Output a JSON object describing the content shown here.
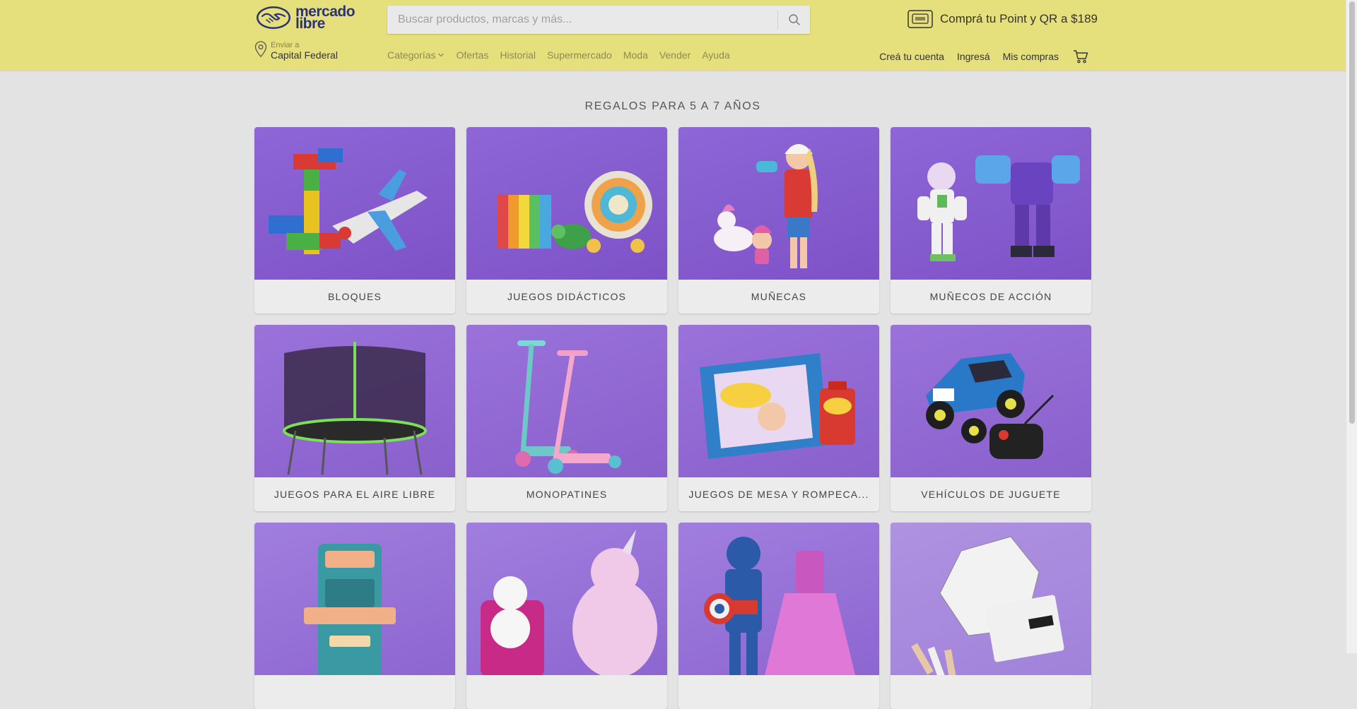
{
  "header": {
    "logo_line1": "mercado",
    "logo_line2": "libre",
    "search_placeholder": "Buscar productos, marcas y más...",
    "promo": "Comprá tu Point y QR a $189",
    "location_label": "Enviar a",
    "location_value": "Capital Federal",
    "nav": [
      "Categorías",
      "Ofertas",
      "Historial",
      "Supermercado",
      "Moda",
      "Vender",
      "Ayuda"
    ],
    "user_nav": {
      "create_account": "Creá tu cuenta",
      "login": "Ingresá",
      "purchases": "Mis compras"
    },
    "colors": {
      "brand_yellow": "#e6e07c",
      "brand_navy": "#2d3277"
    }
  },
  "main": {
    "title": "REGALOS PARA 5 A 7 AÑOS",
    "categories": [
      {
        "label": "BLOQUES",
        "icon": "blocks-airplane-image"
      },
      {
        "label": "JUEGOS DIDÁCTICOS",
        "icon": "magnetic-balls-turtle-image"
      },
      {
        "label": "MUÑECAS",
        "icon": "doll-unicorn-image"
      },
      {
        "label": "MUÑECOS DE ACCIÓN",
        "icon": "action-figures-image"
      },
      {
        "label": "JUEGOS PARA EL AIRE LIBRE",
        "icon": "trampoline-image"
      },
      {
        "label": "MONOPATINES",
        "icon": "scooters-image"
      },
      {
        "label": "JUEGOS DE MESA Y ROMPECA...",
        "icon": "board-games-image"
      },
      {
        "label": "VEHÍCULOS DE JUGUETE",
        "icon": "rc-car-image"
      },
      {
        "label": "",
        "icon": "tool-bench-image"
      },
      {
        "label": "",
        "icon": "plush-toys-image"
      },
      {
        "label": "",
        "icon": "costumes-image"
      },
      {
        "label": "",
        "icon": "coloring-kit-image"
      }
    ]
  }
}
